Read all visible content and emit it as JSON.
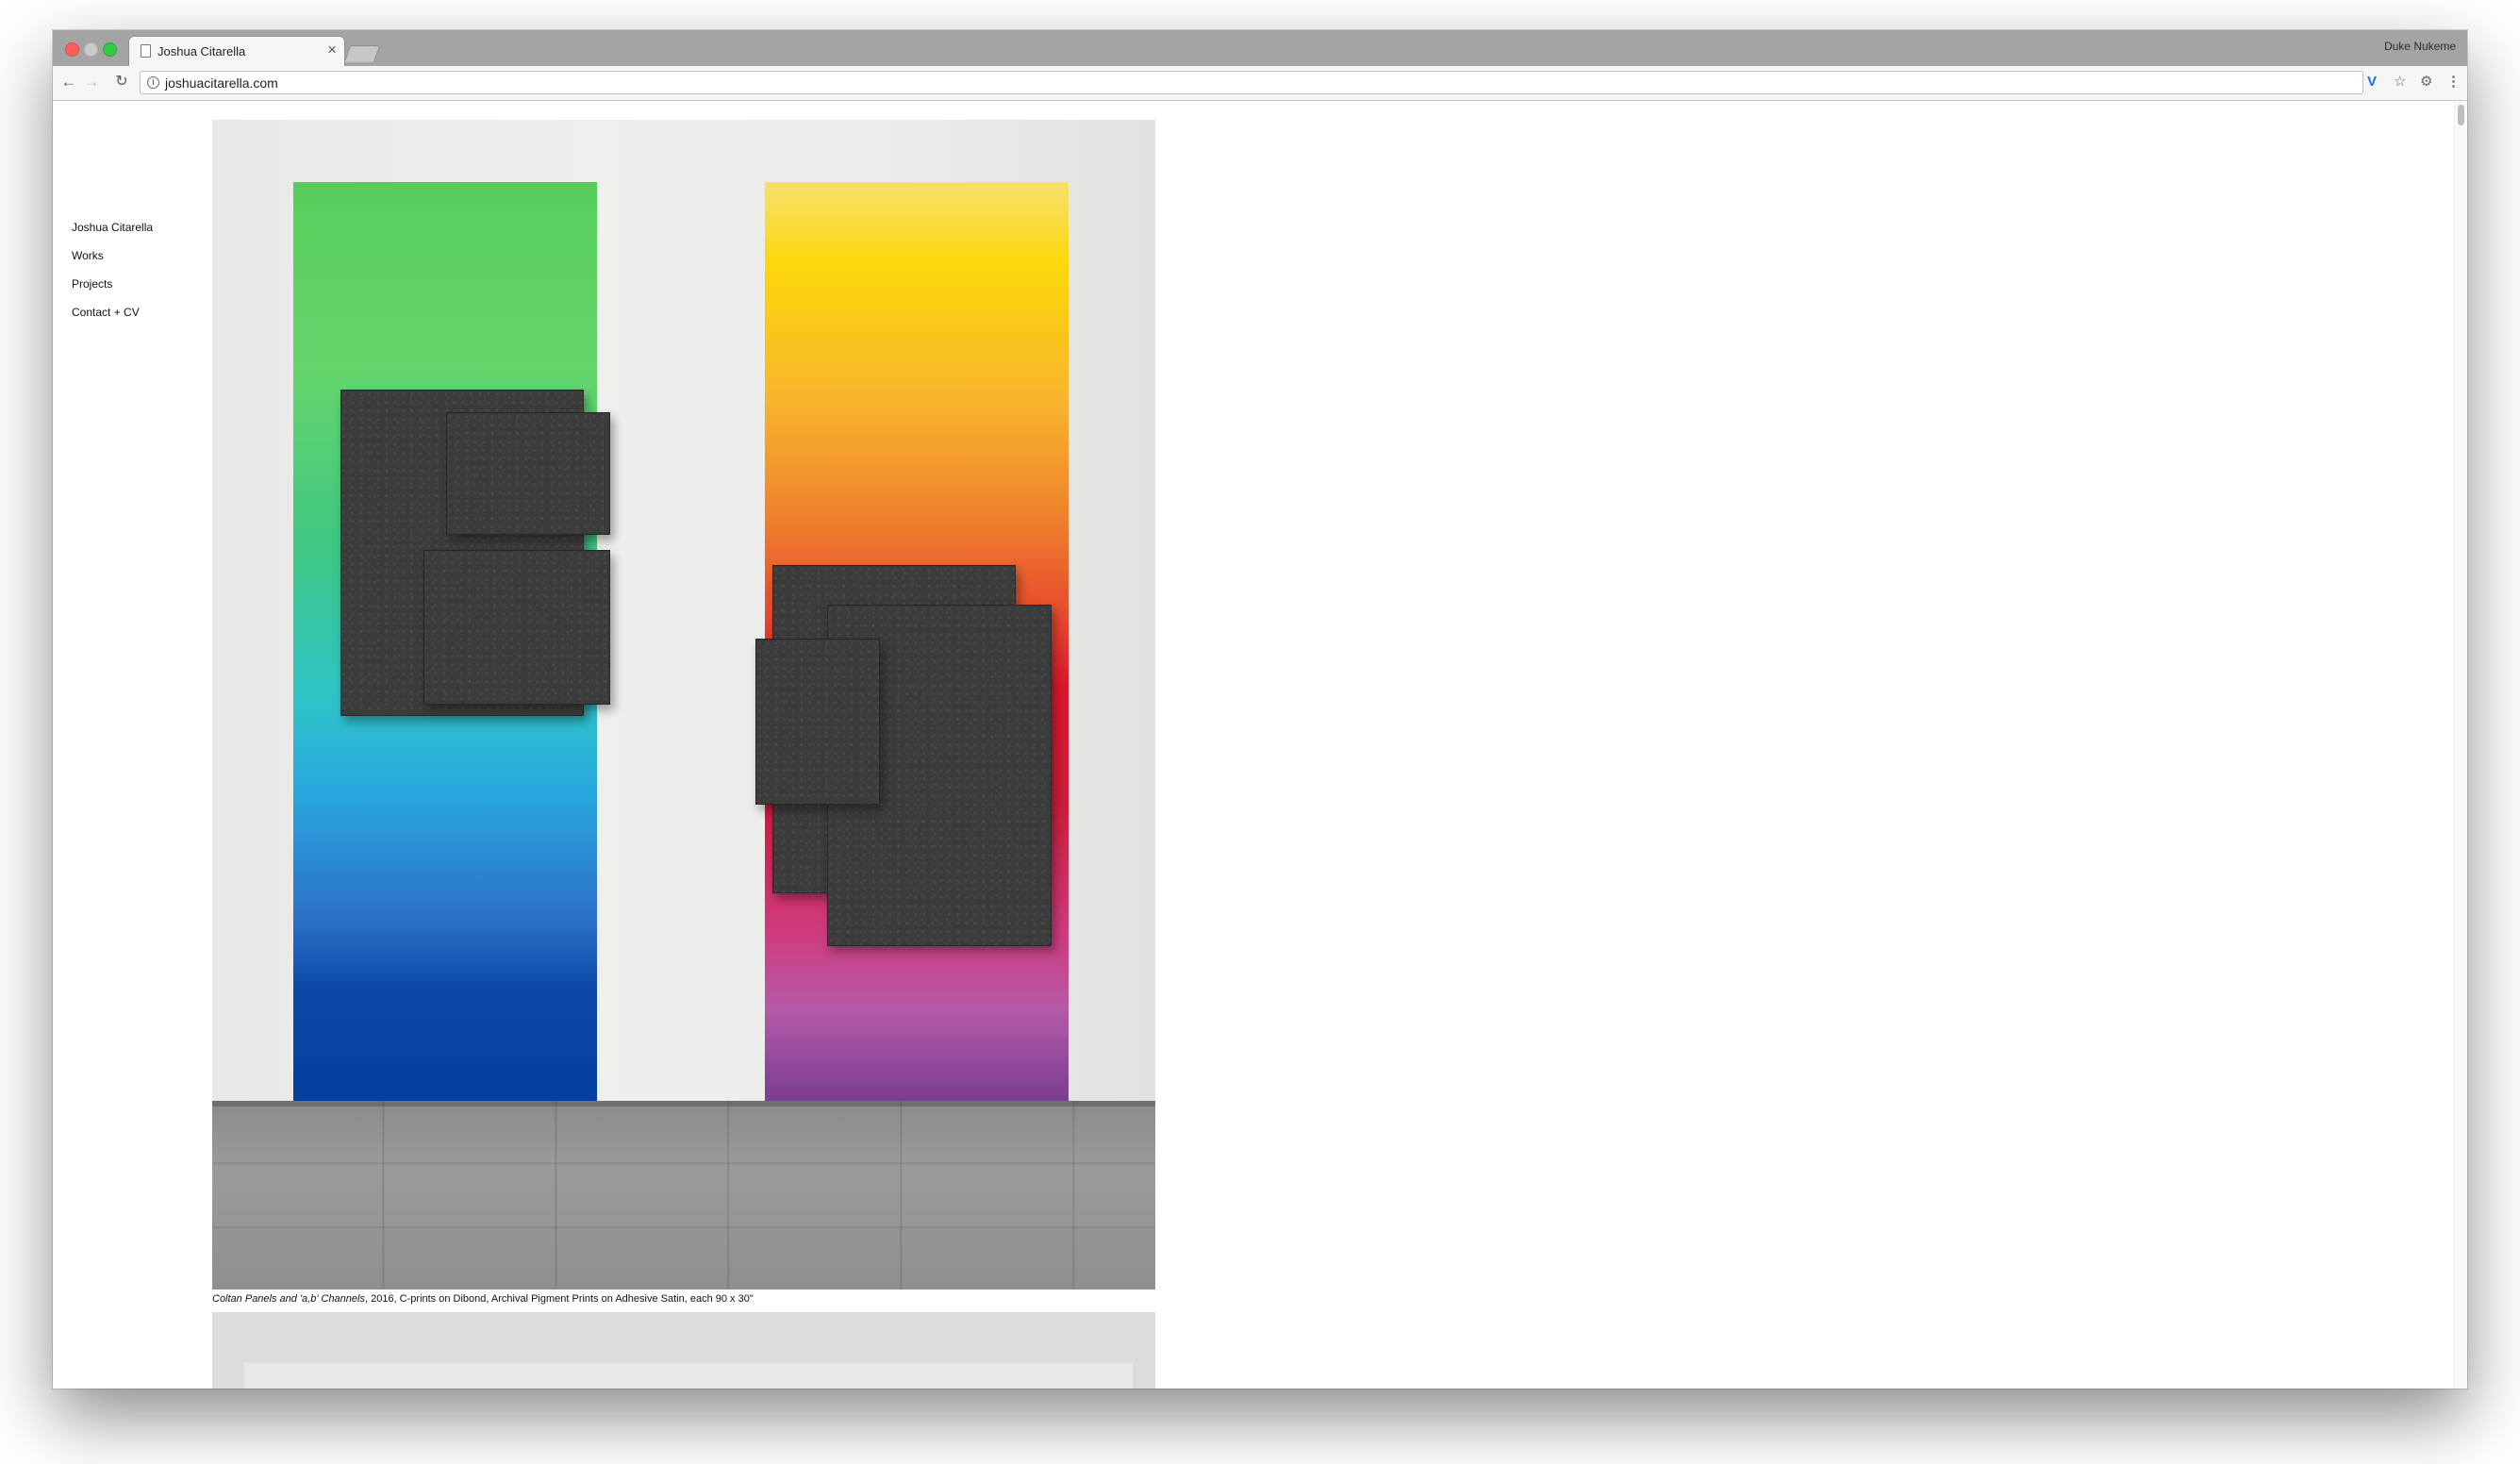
{
  "browser": {
    "tab_title": "Joshua Citarella",
    "tab_close": "×",
    "profile_name": "Duke Nukeme",
    "url": "joshuacitarella.com"
  },
  "sidebar": {
    "items": [
      {
        "label": "Joshua Citarella"
      },
      {
        "label": "Works"
      },
      {
        "label": "Projects"
      },
      {
        "label": "Contact + CV"
      }
    ]
  },
  "artwork": {
    "caption_title": "Coltan Panels and 'a,b' Channels",
    "caption_details": ", 2016, C-prints on Dibond, Archival Pigment Prints on Adhesive Satin, each 90 x 30\""
  },
  "colors": {
    "accent_ext": "#1e6fd9",
    "close_red": "#fc605b",
    "maximize_green": "#34c84a"
  },
  "icons": {
    "back": "back-arrow-icon",
    "forward": "forward-arrow-icon",
    "reload": "reload-icon",
    "info": "info-icon",
    "star": "bookmark-star-icon",
    "menu": "kebab-menu-icon"
  }
}
